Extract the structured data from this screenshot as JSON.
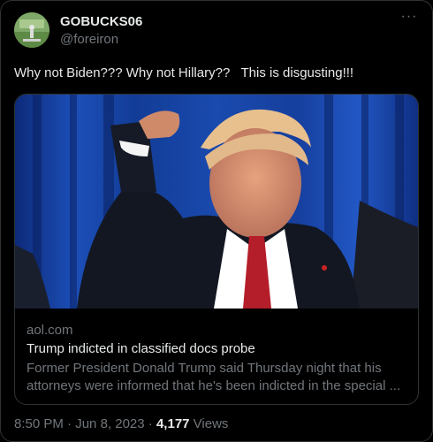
{
  "author": {
    "display_name": "GOBUCKS06",
    "handle": "@foreiron"
  },
  "tweet": {
    "text": "Why not Biden??? Why not Hillary??   This is disgusting!!!"
  },
  "card": {
    "domain": "aol.com",
    "title": "Trump indicted in classified docs probe",
    "description_line1": "Former President Donald Trump said Thursday night that his",
    "description_line2": "attorneys were informed that he's been indicted in the special ..."
  },
  "footer": {
    "time": "8:50 PM",
    "separator1": " · ",
    "date": "Jun 8, 2023",
    "separator2": " · ",
    "views_count": "4,177",
    "views_label": " Views"
  },
  "colors": {
    "background": "#000000",
    "text_primary": "#e7e9ea",
    "text_secondary": "#71767b",
    "border": "#2f3336",
    "curtain_blue": "#1c4fb8"
  },
  "icons": {
    "more": "more-horizontal-icon"
  }
}
